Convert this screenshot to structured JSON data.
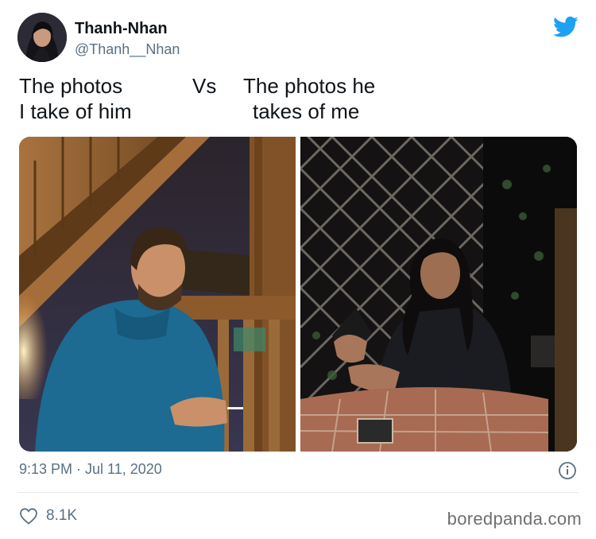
{
  "tweet": {
    "author": {
      "display_name": "Thanh-Nhan",
      "handle": "@Thanh__Nhan",
      "avatar_icon": "user-avatar"
    },
    "platform_icon": "twitter-bird-icon",
    "brand_color": "#1da1f2",
    "text": {
      "left_line1": "The photos",
      "left_line2": "I take of him",
      "separator": "Vs",
      "right_line1": "The photos he",
      "right_line2": "takes of me"
    },
    "media": {
      "left_photo": "photo-man-in-blue-hoodie",
      "right_photo": "photo-woman-at-table-night"
    },
    "timestamp": "9:13 PM · Jul 11, 2020",
    "info_icon": "info-icon",
    "likes": {
      "icon": "heart-icon",
      "count": "8.1K"
    }
  },
  "watermark": "boredpanda.com"
}
